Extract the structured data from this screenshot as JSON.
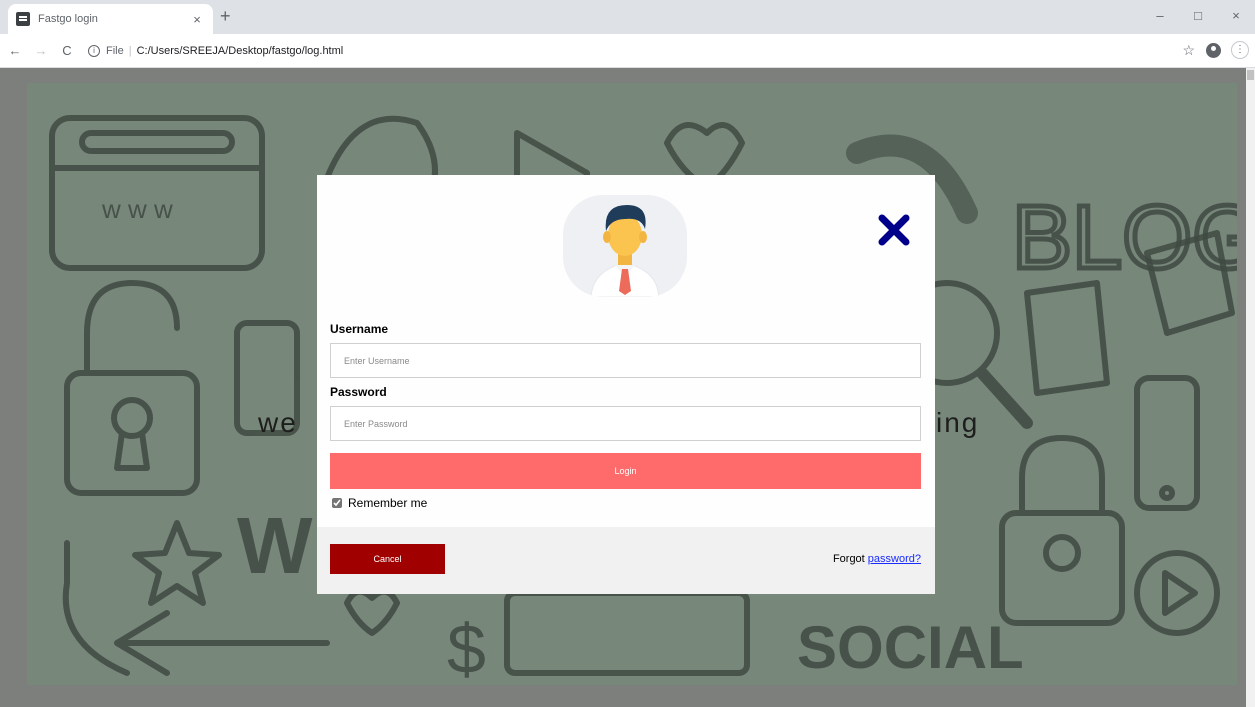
{
  "browser": {
    "tab_title": "Fastgo login",
    "tab_close": "×",
    "new_tab": "+",
    "window_controls": {
      "minimize": "–",
      "maximize": "□",
      "close": "×"
    },
    "nav": {
      "back": "←",
      "forward": "→",
      "reload": "C"
    },
    "address": {
      "info_icon": "i",
      "scheme": "File",
      "separator": "|",
      "url": "C:/Users/SREEJA/Desktop/fastgo/log.html"
    },
    "star_icon": "☆",
    "menu_icon": "⋮"
  },
  "background": {
    "welcome_left": "we",
    "welcome_right": "ing",
    "doodle_texts": {
      "www": "w w w",
      "blog": "BLOG",
      "social": "SOCIAL",
      "w_letter": "W",
      "dollar": "$"
    }
  },
  "modal": {
    "close_icon": "✕",
    "username_label": "Username",
    "username_placeholder": "Enter Username",
    "username_value": "",
    "password_label": "Password",
    "password_placeholder": "Enter Password",
    "password_value": "",
    "login_label": "Login",
    "remember_checked": true,
    "remember_label": "Remember me",
    "cancel_label": "Cancel",
    "forgot_prefix": "Forgot ",
    "forgot_link": "password?"
  },
  "colors": {
    "login_button": "#ff6b6b",
    "cancel_button": "#a00000",
    "close_icon": "#00008b",
    "background_tint": "#77877a"
  }
}
